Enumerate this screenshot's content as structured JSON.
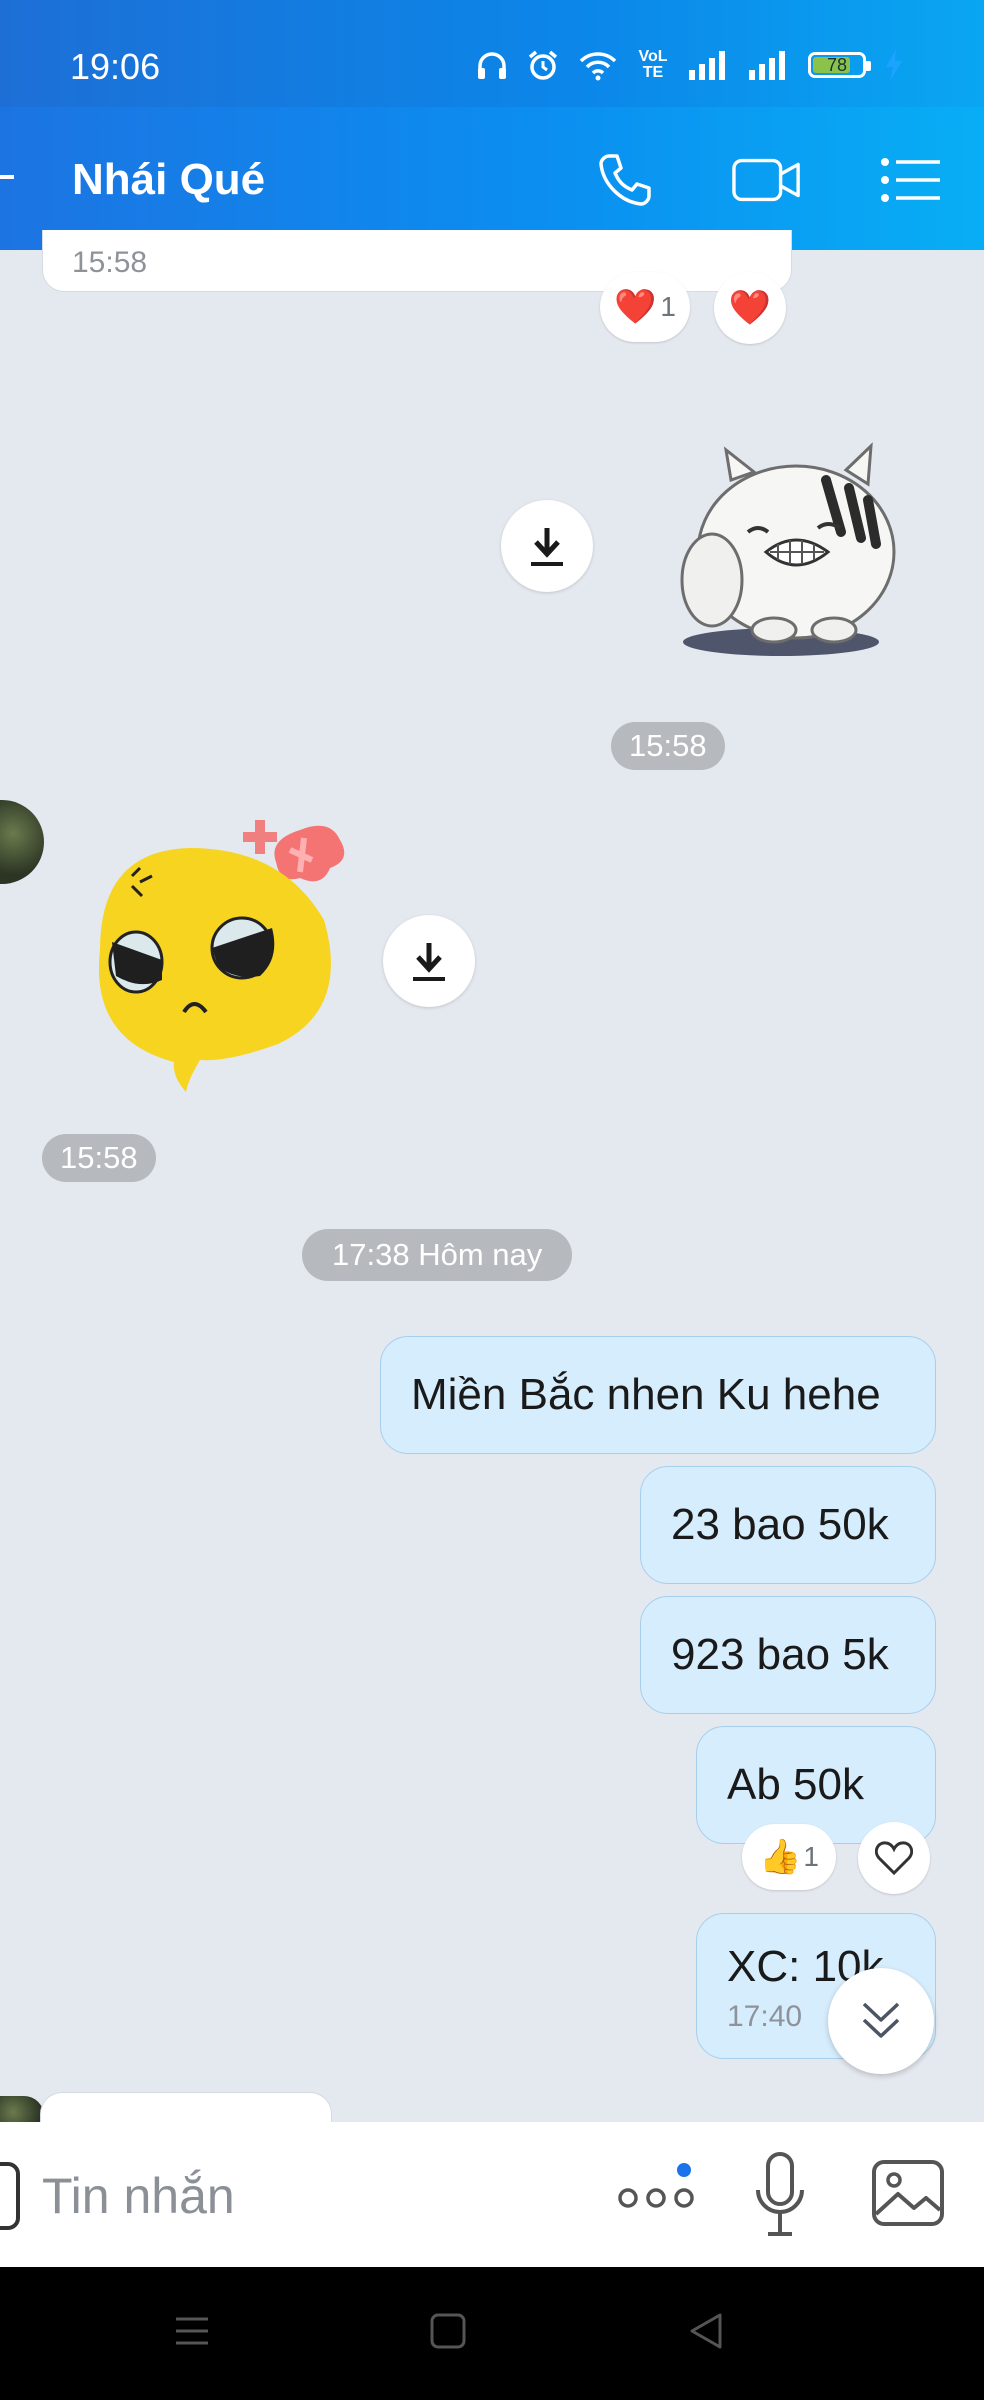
{
  "status_bar": {
    "time": "19:06",
    "battery_level": "78",
    "network_label": "VoLTE",
    "icons": [
      "headphones-icon",
      "alarm-icon",
      "wifi-icon",
      "volte-icon",
      "signal-icon",
      "signal-icon",
      "battery-icon",
      "charging-icon"
    ]
  },
  "header": {
    "title": "Nhái Qué",
    "back_icon": "back-arrow-icon",
    "call_icon": "phone-icon",
    "video_icon": "video-call-icon",
    "menu_icon": "menu-list-icon",
    "colors": {
      "accent": "#0b8ef0"
    }
  },
  "messages": {
    "partial_time": "15:58",
    "reaction_heart_count": "1",
    "sticker_cat_time": "15:58",
    "sticker_angry_time": "15:58",
    "date_separator": "17:38 Hôm nay",
    "outgoing": [
      {
        "text": "Miền Bắc nhen Ku hehe"
      },
      {
        "text": "23 bao 50k"
      },
      {
        "text": "923 bao 5k"
      },
      {
        "text": "Ab 50k",
        "reaction": "👍",
        "reaction_count": "1"
      },
      {
        "text": "XC: 10k",
        "time": "17:40"
      }
    ]
  },
  "input": {
    "placeholder": "Tin nhắn",
    "icons": [
      "more-options-icon",
      "microphone-icon",
      "image-gallery-icon"
    ]
  },
  "navigation": {
    "icons": [
      "recent-apps-icon",
      "home-icon",
      "back-icon"
    ]
  }
}
